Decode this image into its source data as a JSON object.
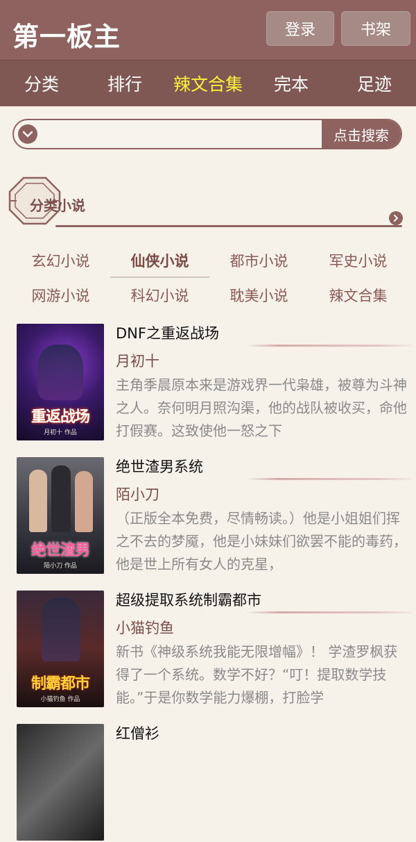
{
  "header": {
    "site_title": "第一板主",
    "login_label": "登录",
    "shelf_label": "书架"
  },
  "nav": {
    "items": [
      "分类",
      "排行",
      "辣文合集",
      "完本",
      "足迹"
    ],
    "active_index": 2
  },
  "search": {
    "placeholder": "",
    "button_label": "点击搜索"
  },
  "section": {
    "title": "分类小说"
  },
  "categories": {
    "items": [
      "玄幻小说",
      "仙侠小说",
      "都市小说",
      "军史小说",
      "网游小说",
      "科幻小说",
      "耽美小说",
      "辣文合集"
    ],
    "active_index": 1
  },
  "books": [
    {
      "title": "DNF之重返战场",
      "author": "月初十",
      "description": "主角季晨原本来是游戏界一代枭雄，被尊为斗神之人。奈何明月照沟渠，他的战队被收买，命他打假赛。这致使他一怒之下",
      "cover_text": "重返战场",
      "cover_sub": "月初十 作品"
    },
    {
      "title": "绝世渣男系统",
      "author": "陌小刀",
      "description": "（正版全本免费，尽情畅读。）他是小姐姐们挥之不去的梦魇，他是小妹妹们欲罢不能的毒药，他是世上所有女人的克星，",
      "cover_text": "绝世渣男",
      "cover_sub": "陌小刀 作品"
    },
    {
      "title": "超级提取系统制霸都市",
      "author": "小猫钓鱼",
      "description": "新书《神级系统我能无限增幅》！ 学渣罗枫获得了一个系统。数学不好？“叮！提取数学技能。”于是你数学能力爆棚，打脸学",
      "cover_text": "制霸都市",
      "cover_sub": "小猫钓鱼 作品"
    },
    {
      "title": "红僧衫",
      "author": "",
      "description": "",
      "cover_text": "",
      "cover_sub": ""
    }
  ],
  "colors": {
    "brand": "#8e625e",
    "nav_bg": "#7f5853",
    "nav_active": "#fff23a",
    "page_bg": "#f6f2ea"
  }
}
